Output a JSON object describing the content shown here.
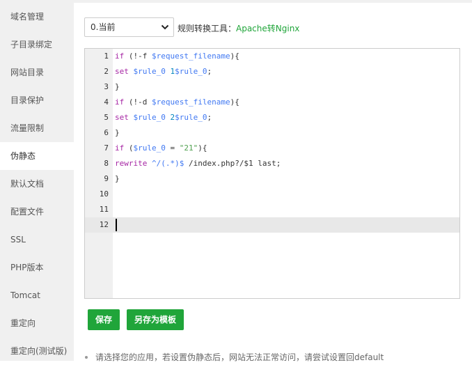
{
  "sidebar": {
    "items": [
      {
        "label": "域名管理",
        "active": false
      },
      {
        "label": "子目录绑定",
        "active": false
      },
      {
        "label": "网站目录",
        "active": false
      },
      {
        "label": "目录保护",
        "active": false
      },
      {
        "label": "流量限制",
        "active": false
      },
      {
        "label": "伪静态",
        "active": true
      },
      {
        "label": "默认文档",
        "active": false
      },
      {
        "label": "配置文件",
        "active": false
      },
      {
        "label": "SSL",
        "active": false
      },
      {
        "label": "PHP版本",
        "active": false
      },
      {
        "label": "Tomcat",
        "active": false
      },
      {
        "label": "重定向",
        "active": false
      },
      {
        "label": "重定向(测试版)",
        "active": false
      }
    ]
  },
  "toolbar": {
    "template_select_value": "0.当前",
    "tool_label": "规则转换工具：",
    "tool_link": "Apache转Nginx"
  },
  "editor": {
    "line_numbers": [
      "1",
      "2",
      "3",
      "4",
      "5",
      "6",
      "7",
      "8",
      "9",
      "10",
      "11",
      "12"
    ],
    "active_line": 12
  },
  "buttons": {
    "save": "保存",
    "save_as_template": "另存为模板"
  },
  "note": "请选择您的应用，若设置伪静态后，网站无法正常访问，请尝试设置回default",
  "colors": {
    "accent": "#20a53a",
    "sidebar_bg": "#f0f0f0",
    "gutter_bg": "#f0f0f0",
    "active_line_bg": "#e8e8e8"
  }
}
